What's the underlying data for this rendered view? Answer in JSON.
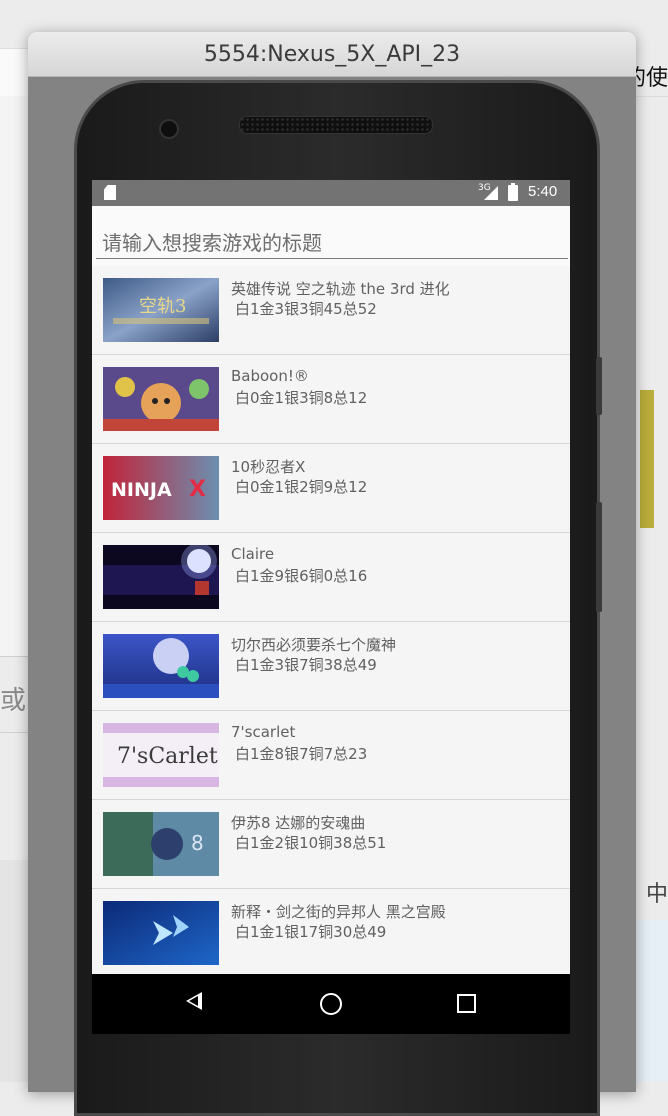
{
  "emulator": {
    "title": "5554:Nexus_5X_API_23"
  },
  "status_bar": {
    "network": "3G",
    "time": "5:40"
  },
  "search": {
    "placeholder": "请输入想搜索游戏的标题"
  },
  "games": [
    {
      "title": "英雄传说 空之轨迹 the 3rd 进化",
      "stats": "白1金3银3铜45总52"
    },
    {
      "title": "Baboon!®",
      "stats": "白0金1银3铜8总12"
    },
    {
      "title": "10秒忍者X",
      "stats": "白0金1银2铜9总12"
    },
    {
      "title": "Claire",
      "stats": "白1金9银6铜0总16"
    },
    {
      "title": "切尔西必须要杀七个魔神",
      "stats": "白1金3银7铜38总49"
    },
    {
      "title": "7'scarlet",
      "stats": "白1金8银7铜7总23"
    },
    {
      "title": "伊苏8 达娜的安魂曲",
      "stats": "白1金2银10铜38总51"
    },
    {
      "title": "新释・剑之街的异邦人 黑之宫殿",
      "stats": "白1金1银17铜30总49"
    }
  ],
  "background": {
    "left_text": "或",
    "right_top_text": "的使",
    "right_bottom_text": "中"
  },
  "colors": {
    "accent_bar": "#b9ac3a",
    "status_bar": "#737373",
    "nav_bar": "#000000"
  }
}
